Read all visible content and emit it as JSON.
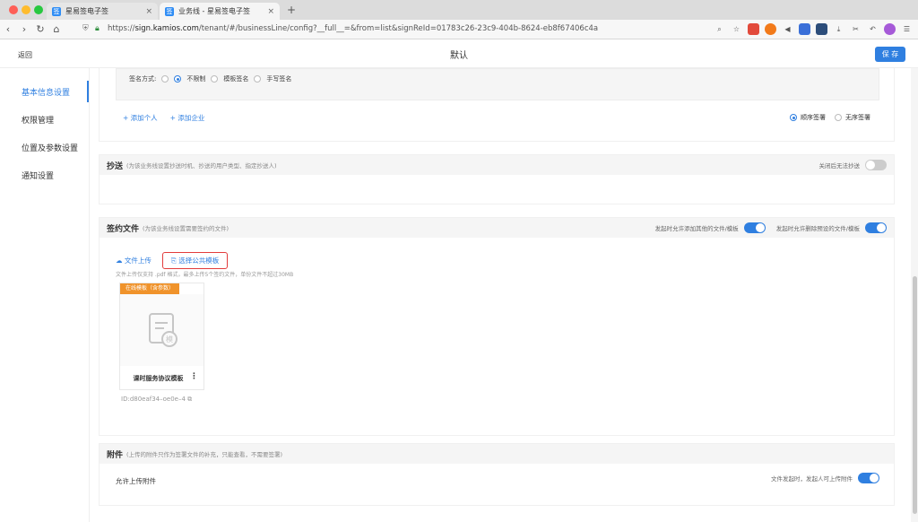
{
  "browser": {
    "tabs": [
      {
        "title": "星易签电子签",
        "icon": "签"
      },
      {
        "title": "业务线 - 星易签电子签",
        "icon": "签"
      }
    ],
    "new_tab": "+",
    "close": "×",
    "url_prefix": "https://",
    "url_host": "sign.kamios.com",
    "url_path": "/tenant/#/businessLine/config?__full__=&from=list&signReId=01783c26-23c9-404b-8624-eb8f67406c4a",
    "extensions": [
      "search-icon",
      "star-icon",
      "game-icon",
      "fox-icon",
      "megaphone-icon",
      "badge-icon",
      "camera-icon",
      "download-icon",
      "scissors-icon",
      "undo-icon",
      "avatar-icon",
      "menu-icon"
    ]
  },
  "header": {
    "back": "返回",
    "title": "默认",
    "save": "保 存"
  },
  "sidebar": {
    "items": [
      {
        "label": "基本信息设置",
        "active": true
      },
      {
        "label": "权限管理",
        "active": false
      },
      {
        "label": "位置及参数设置",
        "active": false
      },
      {
        "label": "通知设置",
        "active": false
      }
    ]
  },
  "signers": {
    "method_label": "签名方式:",
    "options": [
      "不限制",
      "模板签名",
      "手写签名"
    ],
    "add_person": "+ 添加个人",
    "add_company": "+ 添加企业",
    "order": [
      "顺序签署",
      "无序签署"
    ]
  },
  "cc": {
    "title": "抄送",
    "hint": "(为该业务线设置抄送时机、抄送的用户类型、指定抄送人)",
    "toggle_label": "关闭后无法抄送",
    "toggle_on": false
  },
  "files": {
    "title": "签约文件",
    "hint": "(为该业务线设置需要签约的文件)",
    "toggle1_label": "发起时允许添加其他的文件/模板",
    "toggle1_on": true,
    "toggle2_label": "发起时允许删除预设的文件/模板",
    "toggle2_on": true,
    "upload": "文件上传",
    "choose_template": "选择公共模板",
    "note": "文件上传仅支持 .pdf 格式，最多上传5个签约文件，单份文件不超过30MB",
    "card": {
      "badge": "在线模板（含参数）",
      "name": "课时服务协议模板",
      "more": "⋮",
      "id": "ID:d80eaf34–oe0e–4"
    }
  },
  "attachments": {
    "title": "附件",
    "hint": "(上传的附件只作为签署文件的补充，只能查看，不需要签署)",
    "allow_label": "允许上传附件",
    "toggle_label": "文件发起时，发起人可上传附件",
    "toggle_on": true
  }
}
